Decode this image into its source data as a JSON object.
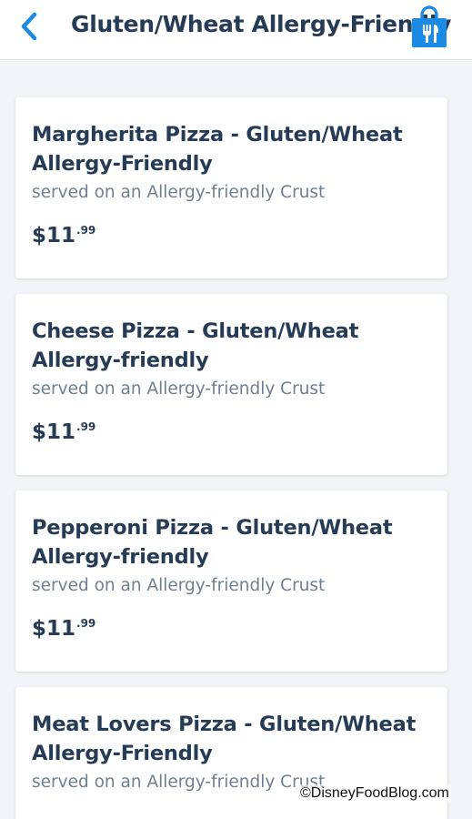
{
  "header": {
    "title": "Gluten/Wheat Allergy-Friendly",
    "back_icon": "chevron-left-icon",
    "cart_icon": "shopping-bag-utensils-icon"
  },
  "colors": {
    "accent": "#1a8ae5",
    "text_primary": "#253b56",
    "text_secondary": "#6f7f92",
    "background": "#f2f4f7"
  },
  "menu_items": [
    {
      "name": "Margherita Pizza - Gluten/Wheat Allergy-Friendly",
      "description": "served on an Allergy-friendly Crust",
      "price_dollars": "$11",
      "price_cents": ".99"
    },
    {
      "name": "Cheese Pizza - Gluten/Wheat Allergy-friendly",
      "description": "served on an Allergy-friendly Crust",
      "price_dollars": "$11",
      "price_cents": ".99"
    },
    {
      "name": "Pepperoni Pizza - Gluten/Wheat Allergy-friendly",
      "description": "served on an Allergy-friendly Crust",
      "price_dollars": "$11",
      "price_cents": ".99"
    },
    {
      "name": "Meat Lovers Pizza - Gluten/Wheat Allergy-Friendly",
      "description": "served on an Allergy-friendly Crust",
      "price_dollars": "$11",
      "price_cents": ".99"
    }
  ],
  "watermark": "©DisneyFoodBlog.com"
}
